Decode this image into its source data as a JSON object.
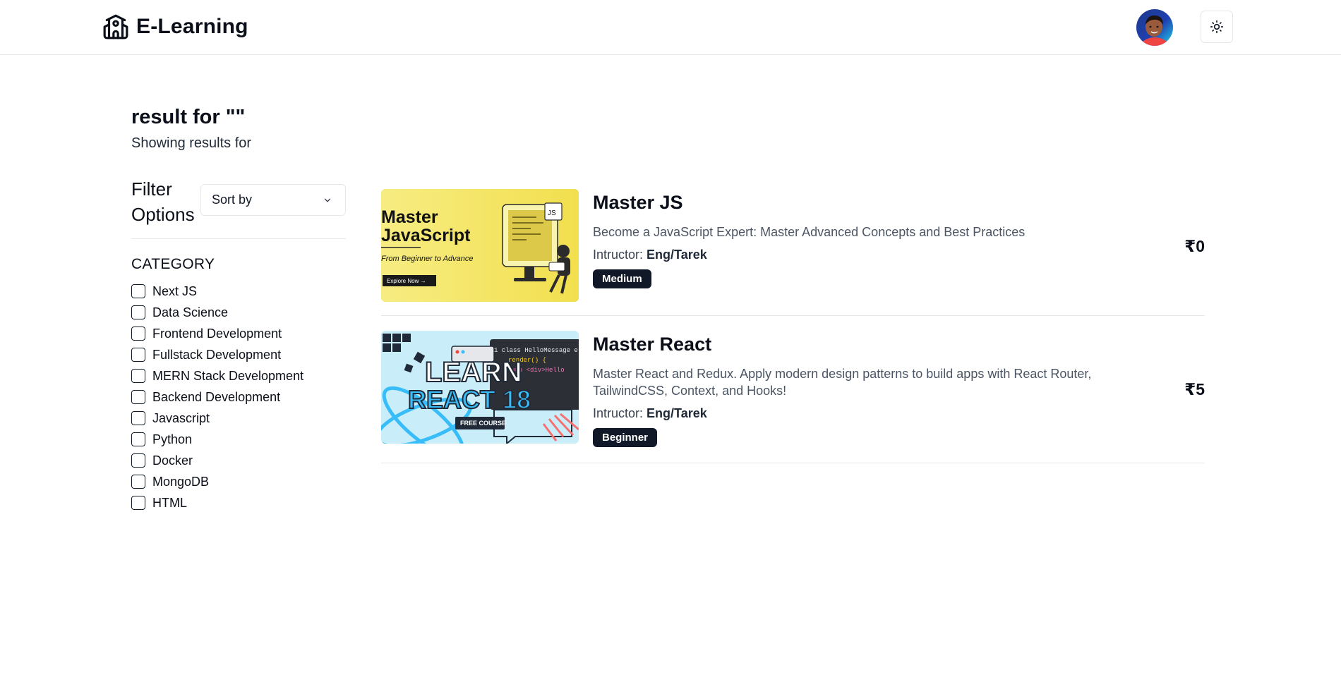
{
  "header": {
    "brand_title": "E-Learning",
    "brand_icon": "school-icon",
    "avatar_alt": "user avatar",
    "theme_icon": "sun-icon"
  },
  "results": {
    "title": "result for \"\"",
    "subtitle": "Showing results for"
  },
  "filter": {
    "title": "Filter Options",
    "sort_placeholder": "Sort by",
    "category_label": "CATEGORY",
    "categories": [
      "Next JS",
      "Data Science",
      "Frontend Development",
      "Fullstack Development",
      "MERN Stack Development",
      "Backend Development",
      "Javascript",
      "Python",
      "Docker",
      "MongoDB",
      "HTML"
    ]
  },
  "courses": [
    {
      "title": "Master JS",
      "description": "Become a JavaScript Expert: Master Advanced Concepts and Best Practices",
      "instructor_label": "Intructor:",
      "instructor": "Eng/Tarek",
      "level": "Medium",
      "price": "₹0",
      "thumb": {
        "line1": "Master",
        "line2": "JavaScript",
        "tagline": "From Beginner to Advance",
        "cta": "Explore Now →",
        "badge": "JS"
      }
    },
    {
      "title": "Master React",
      "description": "Master React and Redux. Apply modern design patterns to build apps with React Router, TailwindCSS, Context, and Hooks!",
      "instructor_label": "Intructor:",
      "instructor": "Eng/Tarek",
      "level": "Beginner",
      "price": "₹5",
      "thumb": {
        "line1": "LEARN",
        "line2": "REACT 18",
        "tag": "FREE COURSE",
        "code1": "1 class HelloMessage e",
        "code2": "render() {",
        "code3": "urn <div>Hello"
      }
    }
  ],
  "colors": {
    "primary_dark": "#111827",
    "border": "#e5e7eb",
    "muted_text": "#4b5563",
    "js_thumb_bg": "#f5e463",
    "react_thumb_bg": "#c9eef9",
    "react_blue": "#38bdf8"
  }
}
